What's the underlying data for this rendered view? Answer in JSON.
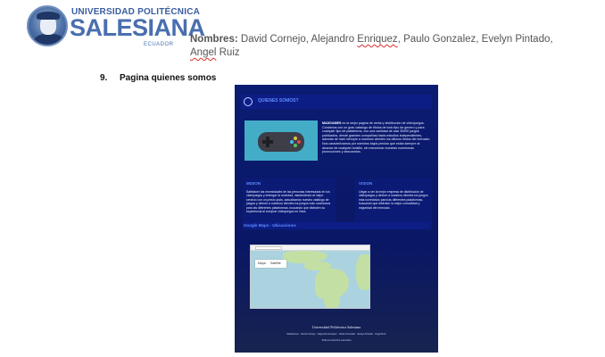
{
  "logo": {
    "top_text": "UNIVERSIDAD POLITÉCNICA",
    "main_text": "SALESIANA",
    "sub_text": "ECUADOR"
  },
  "names": {
    "label": "Nombres:",
    "text_a": " David Cornejo, Alejandro ",
    "misspelled_1": "Enriquez",
    "text_b": ", Paulo Gonzalez, Evelyn Pintado, ",
    "misspelled_2": "Angel",
    "text_c": " Ruiz"
  },
  "heading": {
    "number": "9.",
    "title": "Pagina quienes somos"
  },
  "screenshot": {
    "hero_title": "QUIENES SOMOS?",
    "about_brand": "MADGAMES",
    "about_body": " es la mejor pagina de venta y distribución de videojuegos. Contamos con un gran catalogo de títulos de todo tipo de genero y para cualquier tipo de plataforma, con una cantidad de casi 30000 juegos publicados, desde grandes compañías hasta estudios independientes, además de traer siempre a nuestros clientes los últimos títulos del mercado. Nos caracterizamos por nuestros bajos precios que están siempre al alcance de cualquier bolsillo, sin mencionar nuestras numerosas promociones y descuentos.",
    "mission_title": "MISION",
    "mission_body": "Satisfacer las necesidades de las personas interesadas en los videojuegos y entregar la novedad, manteniendo al mejor servicio con un precio justo, actualizando nuestro catálogo de juegos y ofrecer a nuestros clientes los juegos más novedosos para las diferentes plataformas, buscando que disfruten su experiencia al comprar videojuegos en línea.",
    "vision_title": "VISION",
    "vision_body": "Llegar a ser la mejor empresa de distribución de videojuegos y ofrecer a nuestros clientes los juegos más novedosos para las diferentes plataformas, buscando que disfruten la mejor comodidad y seguridad del mercado.",
    "maps_title": "Google Maps - Ubicaciones",
    "map_btn_1": "Mapa",
    "map_btn_2": "Satélite",
    "footer_1": "Universidad Politécnica Salesiana",
    "footer_2": "MadGames · David Cornejo · Alejandro Enriquez · Paulo Gonzalez · Evelyn Pintado · Angel Ruiz",
    "footer_3": "Todos los derechos reservados"
  }
}
